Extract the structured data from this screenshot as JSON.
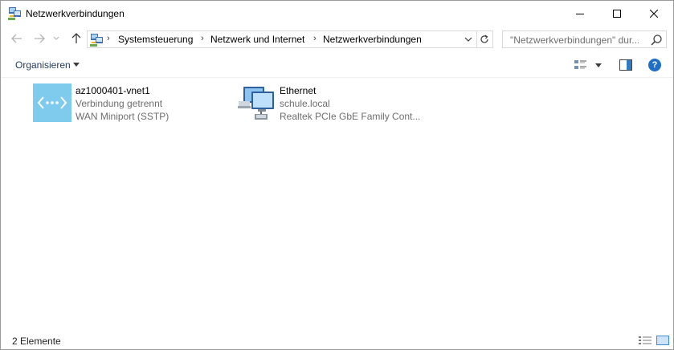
{
  "window": {
    "title": "Netzwerkverbindungen"
  },
  "titlebar": {
    "icon": "network-connections-icon",
    "minimize_icon": "minimize-icon",
    "maximize_icon": "maximize-icon",
    "close_icon": "close-icon"
  },
  "navigation": {
    "back_icon": "arrow-left-icon",
    "forward_icon": "arrow-right-icon",
    "recent_icon": "chevron-down-icon",
    "up_icon": "arrow-up-icon"
  },
  "address": {
    "crumbs": [
      "Systemsteuerung",
      "Netzwerk und Internet",
      "Netzwerkverbindungen"
    ],
    "separator": "›",
    "refresh_icon": "refresh-icon"
  },
  "search": {
    "placeholder": "\"Netzwerkverbindungen\" dur...",
    "icon": "search-icon"
  },
  "commandbar": {
    "organize_label": "Organisieren",
    "view_icon": "change-view-icon",
    "preview_pane_icon": "preview-pane-icon",
    "help_label": "?"
  },
  "connections": [
    {
      "name": "az1000401-vnet1",
      "status": "Verbindung getrennt",
      "device": "WAN Miniport (SSTP)",
      "icon": "vpn-icon"
    },
    {
      "name": "Ethernet",
      "status": "schule.local",
      "device": "Realtek PCIe GbE Family Cont...",
      "icon": "ethernet-icon"
    }
  ],
  "statusbar": {
    "count": "2 Elemente",
    "details_view_icon": "details-view-icon",
    "tiles_view_icon": "tiles-view-icon"
  },
  "colors": {
    "vpn_tile": "#7ecbee",
    "link": "#1e395b",
    "secondary_text": "#6d6d6d",
    "help_blue": "#1f6fc6"
  }
}
